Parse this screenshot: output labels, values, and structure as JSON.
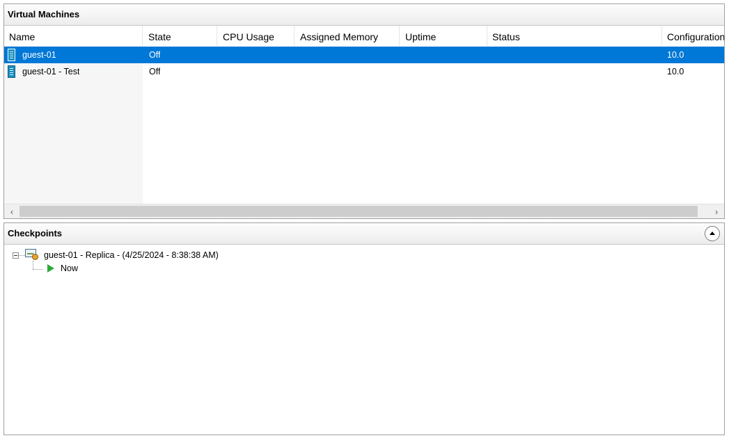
{
  "vm_panel": {
    "title": "Virtual Machines",
    "columns": [
      "Name",
      "State",
      "CPU Usage",
      "Assigned Memory",
      "Uptime",
      "Status",
      "Configuration"
    ],
    "sorted_column": "Name",
    "rows": [
      {
        "name": "guest-01",
        "state": "Off",
        "cpu": "",
        "memory": "",
        "uptime": "",
        "status": "",
        "config": "10.0",
        "selected": true
      },
      {
        "name": "guest-01 - Test",
        "state": "Off",
        "cpu": "",
        "memory": "",
        "uptime": "",
        "status": "",
        "config": "10.0",
        "selected": false
      }
    ],
    "scroll_left": "‹",
    "scroll_right": "›"
  },
  "checkpoints_panel": {
    "title": "Checkpoints",
    "items": [
      {
        "label": "guest-01 - Replica - (4/25/2024 - 8:38:38 AM)",
        "icon": "checkpoint-icon"
      },
      {
        "label": "Now",
        "icon": "play-icon"
      }
    ]
  },
  "colors": {
    "selection": "#0078d7",
    "now_arrow": "#2aaa3a"
  }
}
